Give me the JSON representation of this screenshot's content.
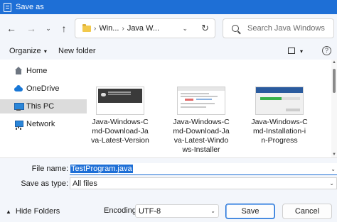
{
  "window": {
    "title": "Save as"
  },
  "nav": {
    "back_icon": "arrow-left-icon",
    "forward_icon": "arrow-right-icon",
    "recent_icon": "chevron-down-icon",
    "up_icon": "arrow-up-icon",
    "breadcrumbs": [
      "Win...",
      "Java W..."
    ],
    "refresh_icon": "refresh-icon",
    "search_placeholder": "Search Java Windows"
  },
  "toolbar": {
    "organize_label": "Organize",
    "new_folder_label": "New folder",
    "view_icon": "view-icon",
    "help_icon": "help-icon"
  },
  "sidebar": {
    "items": [
      {
        "label": "Home",
        "icon": "home-icon",
        "selected": false
      },
      {
        "label": "OneDrive",
        "icon": "cloud-icon",
        "selected": false
      },
      {
        "label": "This PC",
        "icon": "pc-icon",
        "selected": true
      },
      {
        "label": "Network",
        "icon": "network-icon",
        "selected": false
      }
    ]
  },
  "files": [
    {
      "name": "Java-Windows-Cmd-Download-Java-Latest-Version",
      "display": "Java-Windows-C\nmd-Download-Ja\nva-Latest-Version"
    },
    {
      "name": "Java-Windows-Cmd-Download-Java-Latest-Windows-Installer",
      "display": "Java-Windows-C\nmd-Download-Ja\nva-Latest-Windo\nws-Installer"
    },
    {
      "name": "Java-Windows-Cmd-Installation-in-Progress",
      "display": "Java-Windows-C\nmd-Installation-i\nn-Progress"
    }
  ],
  "form": {
    "file_name_label": "File name:",
    "file_name_value": "TestProgram.java",
    "save_type_label": "Save as type:",
    "save_type_value": "All files"
  },
  "footer": {
    "hide_folders_label": "Hide Folders",
    "encoding_label": "Encoding:",
    "encoding_value": "UTF-8",
    "save_label": "Save",
    "cancel_label": "Cancel"
  },
  "colors": {
    "accent": "#1e6fd6",
    "chrome": "#f3f6fb",
    "selected": "#dcdcdc"
  }
}
